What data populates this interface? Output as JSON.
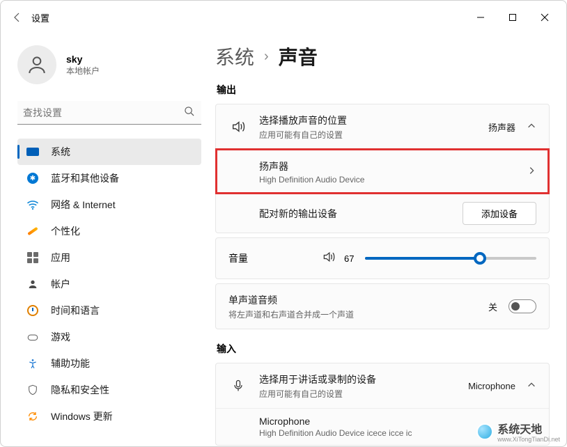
{
  "app_title": "设置",
  "user": {
    "name": "sky",
    "type": "本地帐户"
  },
  "search": {
    "placeholder": "查找设置"
  },
  "nav": [
    {
      "id": "system",
      "label": "系统"
    },
    {
      "id": "bluetooth",
      "label": "蓝牙和其他设备"
    },
    {
      "id": "network",
      "label": "网络 & Internet"
    },
    {
      "id": "personalize",
      "label": "个性化"
    },
    {
      "id": "apps",
      "label": "应用"
    },
    {
      "id": "account",
      "label": "帐户"
    },
    {
      "id": "time",
      "label": "时间和语言"
    },
    {
      "id": "game",
      "label": "游戏"
    },
    {
      "id": "accessibility",
      "label": "辅助功能"
    },
    {
      "id": "privacy",
      "label": "隐私和安全性"
    },
    {
      "id": "update",
      "label": "Windows 更新"
    }
  ],
  "breadcrumb": {
    "parent": "系统",
    "current": "声音"
  },
  "sections": {
    "output": "输出",
    "input": "输入"
  },
  "output": {
    "choose": {
      "title": "选择播放声音的位置",
      "sub": "应用可能有自己的设置",
      "value": "扬声器"
    },
    "device": {
      "title": "扬声器",
      "sub": "High Definition Audio Device"
    },
    "pair": {
      "title": "配对新的输出设备",
      "button": "添加设备"
    },
    "volume": {
      "label": "音量",
      "value": "67",
      "percent": 67
    },
    "mono": {
      "title": "单声道音频",
      "sub": "将左声道和右声道合并成一个声道",
      "state": "关"
    }
  },
  "input": {
    "choose": {
      "title": "选择用于讲话或录制的设备",
      "sub": "应用可能有自己的设置",
      "value": "Microphone"
    },
    "device": {
      "title": "Microphone",
      "sub": "High Definition Audio Device icece icce ic"
    }
  },
  "watermark": {
    "text": "系统天地",
    "url": "www.XiTongTianDi.net"
  }
}
